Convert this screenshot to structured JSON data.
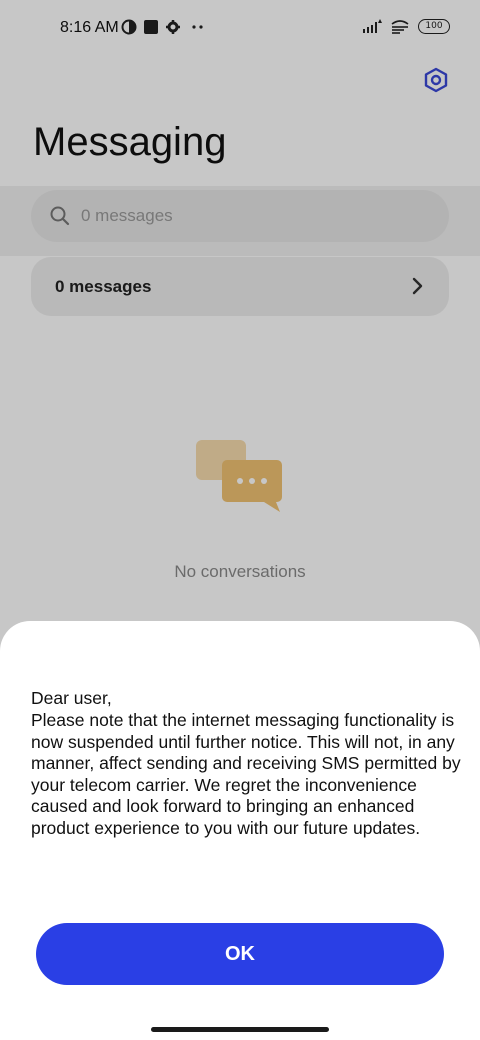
{
  "status_bar": {
    "time": "8:16 AM",
    "battery": "100"
  },
  "header": {
    "title": "Messaging",
    "settings_icon": "settings-hex-icon"
  },
  "search": {
    "placeholder": "0 messages"
  },
  "summary": {
    "label": "0 messages"
  },
  "empty_state": {
    "text": "No conversations"
  },
  "dialog": {
    "greeting": "Dear user,",
    "body": "Please note that the internet messaging functionality is now suspended until further notice. This will not, in any manner, affect sending and receiving SMS permitted by your telecom carrier. We regret the inconvenience caused and look forward to bringing an enhanced product experience to you with our future updates.",
    "ok_label": "OK"
  },
  "colors": {
    "accent": "#2a3fe5",
    "settings_icon": "#3a48d6",
    "illustration": "#f0c272"
  }
}
